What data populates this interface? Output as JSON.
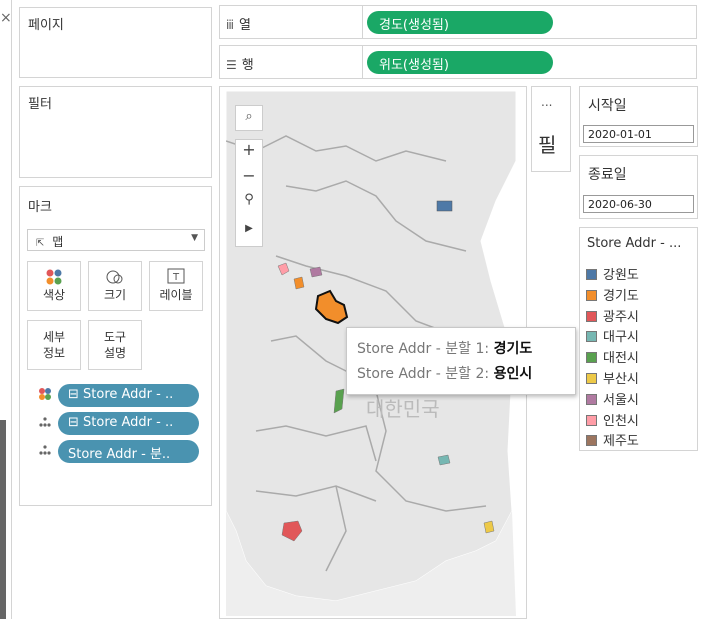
{
  "panels": {
    "pages_title": "페이지",
    "filters_title": "필터",
    "marks_title": "마크"
  },
  "shelves": {
    "columns_label": "열",
    "rows_label": "행",
    "columns_pill": "경도(생성됨)",
    "rows_pill": "위도(생성됨)"
  },
  "marks": {
    "type_label": "맵",
    "buttons": {
      "color": "색상",
      "size": "크기",
      "label": "레이블",
      "detail": "세부\n정보",
      "tooltip": "도구\n설명"
    },
    "pills": [
      "⊟ Store Addr - ..",
      "⊟ Store Addr - ..",
      "Store Addr - 분.."
    ]
  },
  "filter_card": {
    "dots": "...",
    "label": "필"
  },
  "start_date": {
    "title": "시작일",
    "value": "2020-01-01"
  },
  "end_date": {
    "title": "종료일",
    "value": "2020-06-30"
  },
  "legend": {
    "title": "Store Addr - ...",
    "items": [
      {
        "label": "강원도",
        "color": "#4e79a7"
      },
      {
        "label": "경기도",
        "color": "#f28e2b"
      },
      {
        "label": "광주시",
        "color": "#e15759"
      },
      {
        "label": "대구시",
        "color": "#76b7b2"
      },
      {
        "label": "대전시",
        "color": "#59a14f"
      },
      {
        "label": "부산시",
        "color": "#edc948"
      },
      {
        "label": "서울시",
        "color": "#b07aa1"
      },
      {
        "label": "인천시",
        "color": "#ff9da7"
      },
      {
        "label": "제주도",
        "color": "#9c755f"
      }
    ]
  },
  "map": {
    "country_label": "대한민국",
    "tooltip": {
      "line1_label": "Store Addr - 분할 1:",
      "line1_value": "경기도",
      "line2_label": "Store Addr - 분할 2:",
      "line2_value": "용인시"
    }
  },
  "toolbar": {
    "close_glyph": "×"
  }
}
